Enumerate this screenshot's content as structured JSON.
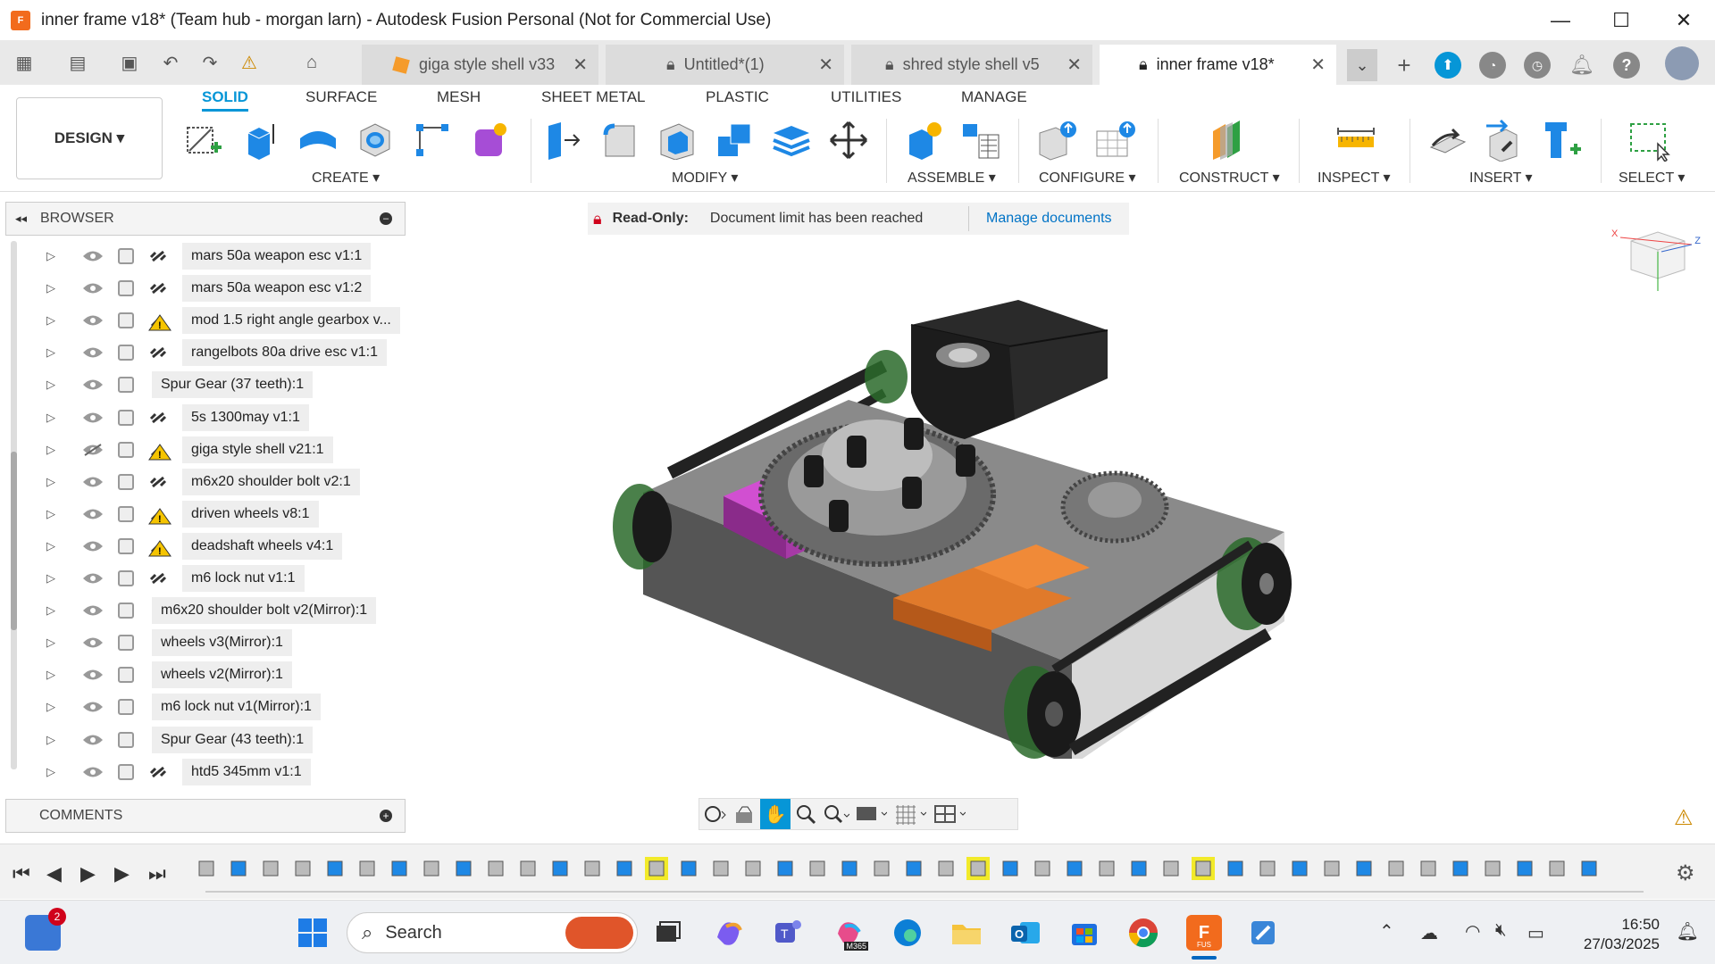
{
  "window": {
    "title": "inner frame v18* (Team hub - morgan larn) - Autodesk Fusion Personal (Not for Commercial Use)",
    "app_logo": "F",
    "controls": [
      "minimize-icon",
      "maximize-icon",
      "close-icon"
    ]
  },
  "doc_tabs": [
    {
      "label": "giga style shell v33",
      "icon": "cube-icon",
      "active": false
    },
    {
      "label": "Untitled*(1)",
      "icon": "lock-icon",
      "active": false
    },
    {
      "label": "shred style shell v5",
      "icon": "lock-icon",
      "active": false
    },
    {
      "label": "inner frame v18*",
      "icon": "lock-icon",
      "active": true
    }
  ],
  "ribbon": {
    "workspace": "DESIGN ▾",
    "tabs": [
      "SOLID",
      "SURFACE",
      "MESH",
      "SHEET METAL",
      "PLASTIC",
      "UTILITIES",
      "MANAGE"
    ],
    "groups": [
      "CREATE ▾",
      "MODIFY ▾",
      "ASSEMBLE ▾",
      "CONFIGURE ▾",
      "CONSTRUCT ▾",
      "INSPECT ▾",
      "INSERT ▾",
      "SELECT ▾"
    ]
  },
  "browser": {
    "title": "BROWSER",
    "items": [
      {
        "label": "mars 50a weapon esc v1:1",
        "linked": true,
        "warning": false,
        "hidden": false
      },
      {
        "label": "mars 50a weapon esc v1:2",
        "linked": true,
        "warning": false,
        "hidden": false
      },
      {
        "label": "mod 1.5 right angle gearbox v...",
        "linked": false,
        "warning": true,
        "hidden": false
      },
      {
        "label": "rangelbots 80a drive esc v1:1",
        "linked": true,
        "warning": false,
        "hidden": false
      },
      {
        "label": "Spur Gear (37 teeth):1",
        "linked": false,
        "warning": false,
        "hidden": false
      },
      {
        "label": "5s 1300may v1:1",
        "linked": true,
        "warning": false,
        "hidden": false
      },
      {
        "label": "giga style shell v21:1",
        "linked": false,
        "warning": true,
        "hidden": true
      },
      {
        "label": "m6x20 shoulder bolt v2:1",
        "linked": true,
        "warning": false,
        "hidden": false
      },
      {
        "label": "driven wheels v8:1",
        "linked": false,
        "warning": true,
        "hidden": false
      },
      {
        "label": "deadshaft wheels v4:1",
        "linked": false,
        "warning": true,
        "hidden": false
      },
      {
        "label": "m6 lock nut v1:1",
        "linked": true,
        "warning": false,
        "hidden": false
      },
      {
        "label": "m6x20 shoulder bolt v2(Mirror):1",
        "linked": false,
        "warning": false,
        "hidden": false
      },
      {
        "label": "wheels v3(Mirror):1",
        "linked": false,
        "warning": false,
        "hidden": false
      },
      {
        "label": "wheels v2(Mirror):1",
        "linked": false,
        "warning": false,
        "hidden": false
      },
      {
        "label": "m6 lock nut v1(Mirror):1",
        "linked": false,
        "warning": false,
        "hidden": false
      },
      {
        "label": "Spur Gear (43 teeth):1",
        "linked": false,
        "warning": false,
        "hidden": false
      },
      {
        "label": "htd5 345mm v1:1",
        "linked": true,
        "warning": false,
        "hidden": false
      }
    ]
  },
  "comments": {
    "title": "COMMENTS"
  },
  "readonly_banner": {
    "label": "Read-Only:",
    "message": "Document limit has been reached",
    "link": "Manage documents"
  },
  "viewcube": {
    "x_label": "X",
    "z_label": "Z"
  },
  "taskbar": {
    "search_placeholder": "Search",
    "badge_count": "2",
    "time": "16:50",
    "date": "27/03/2025",
    "m365_label": "M365",
    "fusion_label": "FUS"
  },
  "colors": {
    "accent": "#0696d7",
    "fusion_orange": "#f26b1d",
    "warning": "#f5c400"
  }
}
